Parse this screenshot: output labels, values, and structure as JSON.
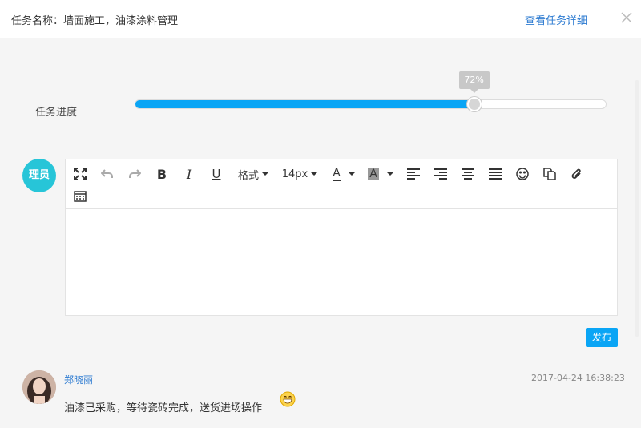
{
  "header": {
    "title": "任务名称：墙面施工，油漆涂料管理",
    "detail_link": "查看任务详细"
  },
  "progress": {
    "label": "任务进度",
    "value": 72,
    "value_text": "72%",
    "accent": "#0aa5f5"
  },
  "editor": {
    "user_badge": "理员",
    "badge_color": "#27c5d8",
    "format_label": "格式",
    "font_size_label": "14px",
    "font_color_label": "A",
    "bg_color_label": "A",
    "toolbar_icons": [
      "fullscreen-icon",
      "undo-icon",
      "redo-icon",
      "bold-icon",
      "italic-icon",
      "underline-icon",
      "align-left-icon",
      "align-right-icon",
      "align-center-icon",
      "align-justify-icon",
      "emoji-icon",
      "copy-icon",
      "attachment-icon",
      "table-icon"
    ],
    "publish_label": "发布"
  },
  "comments": [
    {
      "name": "郑晓丽",
      "time": "2017-04-24 16:38:23",
      "text": "油漆已采购，等待瓷砖完成，送货进场操作"
    }
  ]
}
